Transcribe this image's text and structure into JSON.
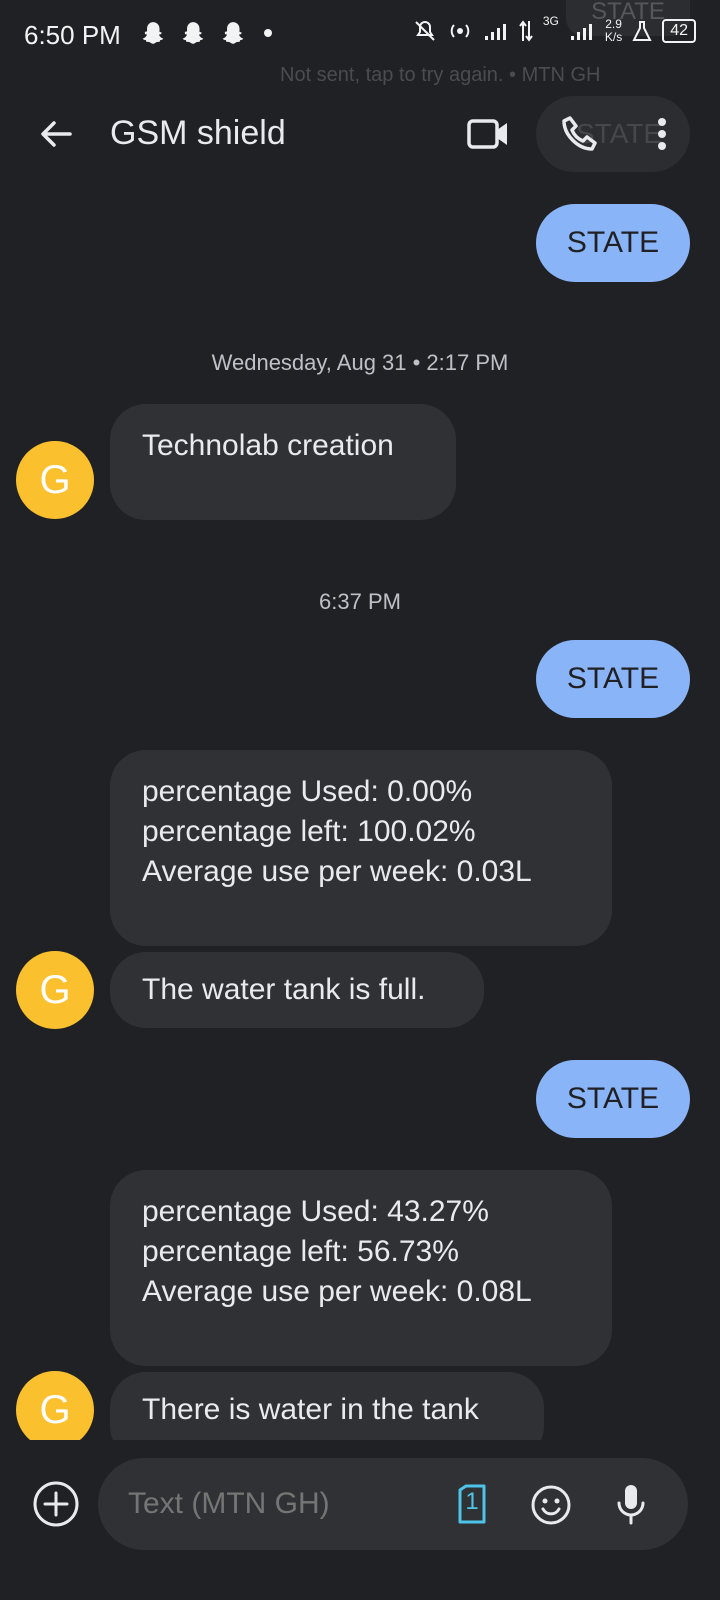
{
  "status_bar": {
    "time": "6:50 PM",
    "network_type": "3G",
    "speed_value": "2.9",
    "speed_unit": "K/s",
    "battery": "42"
  },
  "background_notification": {
    "text": "Not sent, tap to try again. • MTN GH",
    "bubble": "STATE",
    "pill_text": "STATE"
  },
  "app_bar": {
    "title": "GSM shield"
  },
  "conversation": {
    "messages": [
      {
        "type": "outgoing",
        "text": "STATE"
      },
      {
        "type": "timestamp",
        "text": "Wednesday, Aug 31 • 2:17 PM"
      },
      {
        "type": "incoming",
        "avatar": "G",
        "text": "Technolab creation"
      },
      {
        "type": "timestamp",
        "text": "6:37 PM"
      },
      {
        "type": "outgoing",
        "text": "STATE"
      },
      {
        "type": "incoming",
        "lines": [
          "percentage Used: 0.00%",
          "percentage left: 100.02%",
          "Average use per week: 0.03L"
        ]
      },
      {
        "type": "incoming",
        "avatar": "G",
        "text": "The water tank is full."
      },
      {
        "type": "outgoing",
        "text": "STATE"
      },
      {
        "type": "incoming",
        "lines": [
          "percentage Used: 43.27%",
          "percentage left: 56.73%",
          "Average use per week: 0.08L"
        ]
      },
      {
        "type": "incoming",
        "avatar": "G",
        "text": "There is water in the tank"
      }
    ]
  },
  "composer": {
    "placeholder": "Text (MTN GH)",
    "sim_slot": "1"
  }
}
